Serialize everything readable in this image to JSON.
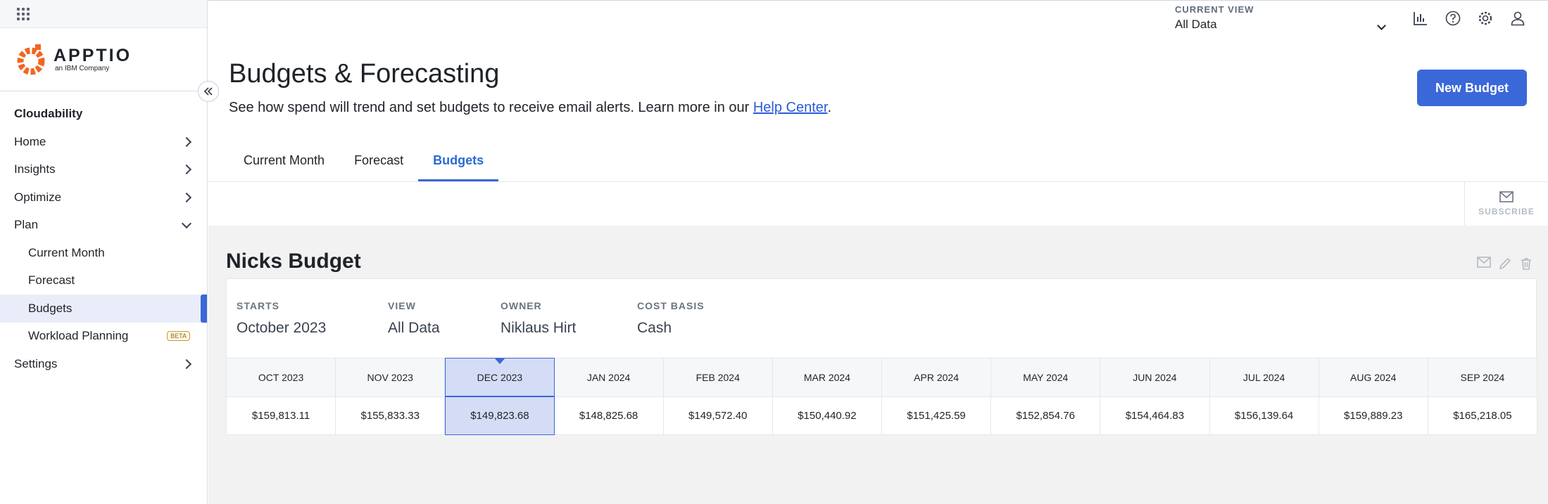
{
  "sidebar": {
    "logo": {
      "word": "APPTIO",
      "sub": "an IBM Company"
    },
    "section": "Cloudability",
    "items": [
      {
        "label": "Home"
      },
      {
        "label": "Insights"
      },
      {
        "label": "Optimize"
      },
      {
        "label": "Plan"
      },
      {
        "label": "Current Month"
      },
      {
        "label": "Forecast"
      },
      {
        "label": "Budgets"
      },
      {
        "label": "Workload Planning",
        "badge": "BETA"
      },
      {
        "label": "Settings"
      }
    ]
  },
  "header": {
    "current_view_label": "CURRENT VIEW",
    "current_view_value": "All Data",
    "icons": [
      "chart-icon",
      "help-icon",
      "settings-icon",
      "user-icon"
    ]
  },
  "page": {
    "title": "Budgets & Forecasting",
    "desc_prefix": "See how spend will trend and set budgets to receive email alerts. Learn more in our ",
    "desc_link": "Help Center",
    "desc_suffix": ".",
    "new_budget": "New Budget"
  },
  "tabs": [
    {
      "label": "Current Month"
    },
    {
      "label": "Forecast"
    },
    {
      "label": "Budgets"
    }
  ],
  "subscribe_label": "SUBSCRIBE",
  "budget": {
    "name": "Nicks Budget",
    "meta": [
      {
        "label": "STARTS",
        "value": "October 2023"
      },
      {
        "label": "VIEW",
        "value": "All Data"
      },
      {
        "label": "OWNER",
        "value": "Niklaus Hirt"
      },
      {
        "label": "COST BASIS",
        "value": "Cash"
      }
    ],
    "months": [
      "OCT 2023",
      "NOV 2023",
      "DEC 2023",
      "JAN 2024",
      "FEB 2024",
      "MAR 2024",
      "APR 2024",
      "MAY 2024",
      "JUN 2024",
      "JUL 2024",
      "AUG 2024",
      "SEP 2024"
    ],
    "values": [
      "$159,813.11",
      "$155,833.33",
      "$149,823.68",
      "$148,825.68",
      "$149,572.40",
      "$150,440.92",
      "$151,425.59",
      "$152,854.76",
      "$154,464.83",
      "$156,139.64",
      "$159,889.23",
      "$165,218.05"
    ],
    "selected_month": "DEC 2023"
  },
  "colors": {
    "accent": "#3b68d8",
    "link": "#2a5bd7",
    "logo": "#f26522"
  }
}
